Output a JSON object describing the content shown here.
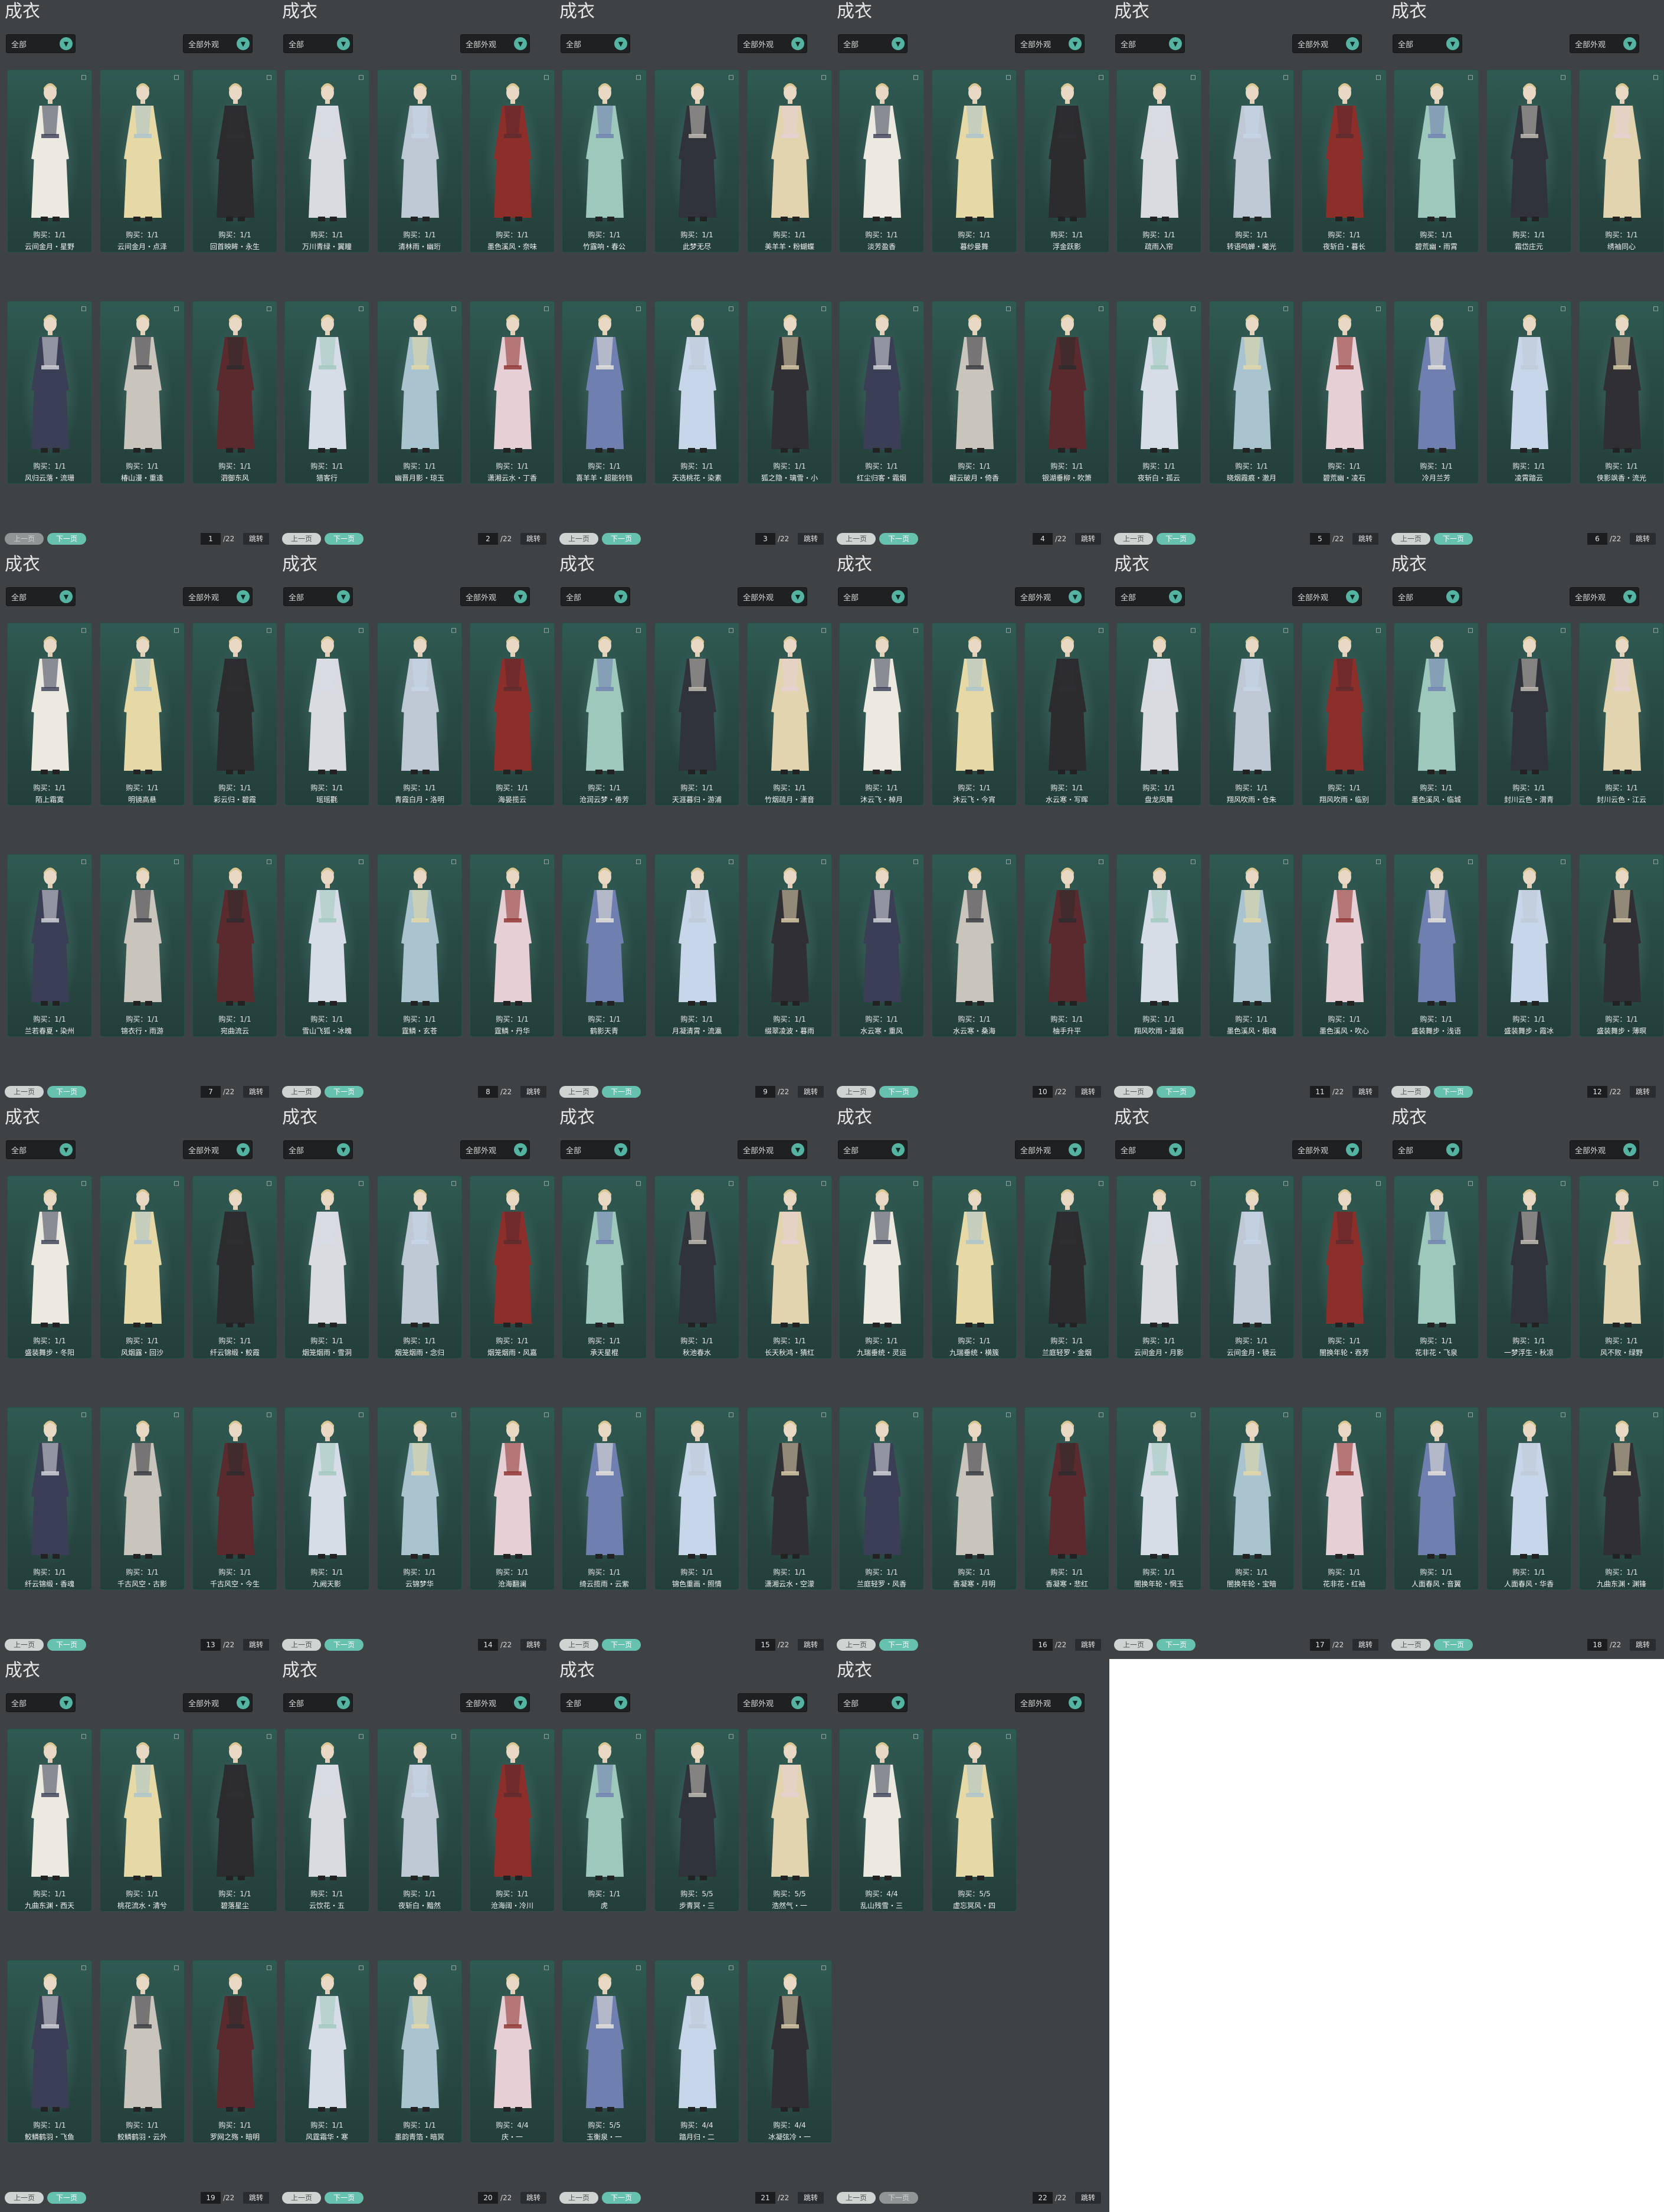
{
  "title": "成衣",
  "filter_a": "全部",
  "filter_b": "全部外观",
  "prev_label": "上一页",
  "next_label": "下一页",
  "jump_label": "跳转",
  "total_pages": "22",
  "pages": [
    {
      "page": "1",
      "items": [
        {
          "b": "购买：1/1",
          "n": "云间金月・星野"
        },
        {
          "b": "购买：1/1",
          "n": "云间金月・点泽"
        },
        {
          "b": "购买：1/1",
          "n": "回首映眸・永生"
        },
        {
          "b": "购买：1/1",
          "n": "风归云落・流珊"
        },
        {
          "b": "购买：1/1",
          "n": "椿山漫・重逢"
        },
        {
          "b": "购买：1/1",
          "n": "泗御东风"
        }
      ]
    },
    {
      "page": "2",
      "items": [
        {
          "b": "购买：1/1",
          "n": "万川青绿・翼瞳"
        },
        {
          "b": "购买：1/1",
          "n": "清林雨・幽珩"
        },
        {
          "b": "购买：1/1",
          "n": "墨色溪风・奈味"
        },
        {
          "b": "购买：1/1",
          "n": "猎客行"
        },
        {
          "b": "购买：1/1",
          "n": "幽晋月影・琼玉"
        },
        {
          "b": "购买：1/1",
          "n": "潇湘云水・丁香"
        }
      ]
    },
    {
      "page": "3",
      "items": [
        {
          "b": "购买：1/1",
          "n": "竹露响・春公"
        },
        {
          "b": "购买：1/1",
          "n": "此梦无尽"
        },
        {
          "b": "购买：1/1",
          "n": "美羊羊・粉蝴蝶"
        },
        {
          "b": "购买：1/1",
          "n": "喜羊羊・超能铃铛"
        },
        {
          "b": "购买：1/1",
          "n": "天选桃花・染素"
        },
        {
          "b": "购买：1/1",
          "n": "狐之隐・璃雪・小"
        }
      ]
    },
    {
      "page": "4",
      "items": [
        {
          "b": "购买：1/1",
          "n": "淡芳盈香"
        },
        {
          "b": "购买：1/1",
          "n": "暮纱曼舞"
        },
        {
          "b": "购买：1/1",
          "n": "浮金跃影"
        },
        {
          "b": "购买：1/1",
          "n": "红尘归客・霜烟"
        },
        {
          "b": "购买：1/1",
          "n": "翩云破月・倚香"
        },
        {
          "b": "购买：1/1",
          "n": "银湖垂柳・吹箫"
        }
      ]
    },
    {
      "page": "5",
      "items": [
        {
          "b": "购买：1/1",
          "n": "疏雨入帘"
        },
        {
          "b": "购买：1/1",
          "n": "转语鸣蝉・曦光"
        },
        {
          "b": "购买：1/1",
          "n": "夜斩白・暮长"
        },
        {
          "b": "购买：1/1",
          "n": "夜斩白・孤云"
        },
        {
          "b": "购买：1/1",
          "n": "晓烟霞痕・澈月"
        },
        {
          "b": "购买：1/1",
          "n": "碧荒幽・凌石"
        }
      ]
    },
    {
      "page": "6",
      "items": [
        {
          "b": "购买：1/1",
          "n": "碧荒幽・雨霄"
        },
        {
          "b": "购买：1/1",
          "n": "霜岱庄元"
        },
        {
          "b": "购买：1/1",
          "n": "绣袖同心"
        },
        {
          "b": "购买：1/1",
          "n": "冷月兰芳"
        },
        {
          "b": "购买：1/1",
          "n": "凌霄踏云"
        },
        {
          "b": "购买：1/1",
          "n": "侠影飒香・流光"
        }
      ]
    },
    {
      "page": "7",
      "items": [
        {
          "b": "购买：1/1",
          "n": "陌上霜寞"
        },
        {
          "b": "购买：1/1",
          "n": "明镜高悬"
        },
        {
          "b": "购买：1/1",
          "n": "彩云归・碧霞"
        },
        {
          "b": "购买：1/1",
          "n": "兰若春夏・染州"
        },
        {
          "b": "购买：1/1",
          "n": "锦衣行・雨游"
        },
        {
          "b": "购买：1/1",
          "n": "宛曲流云"
        }
      ]
    },
    {
      "page": "8",
      "items": [
        {
          "b": "购买：1/1",
          "n": "瑶瑶氍"
        },
        {
          "b": "购买：1/1",
          "n": "青霞白月・洛明"
        },
        {
          "b": "购买：1/1",
          "n": "海晏揽云"
        },
        {
          "b": "购买：1/1",
          "n": "雪山飞狐・冰魄"
        },
        {
          "b": "购买：1/1",
          "n": "霆鳞・玄苍"
        },
        {
          "b": "购买：1/1",
          "n": "霆鳞・丹华"
        }
      ]
    },
    {
      "page": "9",
      "items": [
        {
          "b": "购买：1/1",
          "n": "沧润云梦・倦芳"
        },
        {
          "b": "购买：1/1",
          "n": "天涯暮归・游浦"
        },
        {
          "b": "购买：1/1",
          "n": "竹烟疏月・潇音"
        },
        {
          "b": "购买：1/1",
          "n": "鹤影天青"
        },
        {
          "b": "购买：1/1",
          "n": "月凝清霄・流瀛"
        },
        {
          "b": "购买：1/1",
          "n": "缀翠凌波・暮雨"
        }
      ]
    },
    {
      "page": "10",
      "items": [
        {
          "b": "购买：1/1",
          "n": "沐云飞・棹月"
        },
        {
          "b": "购买：1/1",
          "n": "沐云飞・今宵"
        },
        {
          "b": "购买：1/1",
          "n": "水云寒・写晖"
        },
        {
          "b": "购买：1/1",
          "n": "水云寒・重风"
        },
        {
          "b": "购买：1/1",
          "n": "水云寒・桑海"
        },
        {
          "b": "购买：1/1",
          "n": "柚手升平"
        }
      ]
    },
    {
      "page": "11",
      "items": [
        {
          "b": "购买：1/1",
          "n": "盘龙凤舞"
        },
        {
          "b": "购买：1/1",
          "n": "翔风吹雨・仓朱"
        },
        {
          "b": "购买：1/1",
          "n": "翔风吹雨・临别"
        },
        {
          "b": "购买：1/1",
          "n": "翔风吹雨・道烟"
        },
        {
          "b": "购买：1/1",
          "n": "墨色溪风・烟魂"
        },
        {
          "b": "购买：1/1",
          "n": "墨色溪风・吹心"
        }
      ]
    },
    {
      "page": "12",
      "items": [
        {
          "b": "购买：1/1",
          "n": "墨色溪风・临城"
        },
        {
          "b": "购买：1/1",
          "n": "封川云色・渭青"
        },
        {
          "b": "购买：1/1",
          "n": "封川云色・江云"
        },
        {
          "b": "购买：1/1",
          "n": "盛装舞步・浅语"
        },
        {
          "b": "购买：1/1",
          "n": "盛装舞步・霞冰"
        },
        {
          "b": "购买：1/1",
          "n": "盛装舞步・薄暝"
        }
      ]
    },
    {
      "page": "13",
      "items": [
        {
          "b": "购买：1/1",
          "n": "盛装舞步・冬阳"
        },
        {
          "b": "购买：1/1",
          "n": "风烟露・回沙"
        },
        {
          "b": "购买：1/1",
          "n": "纤云锦缎・鲛霞"
        },
        {
          "b": "购买：1/1",
          "n": "纤云锦缎・香魂"
        },
        {
          "b": "购买：1/1",
          "n": "千古风空・古影"
        },
        {
          "b": "购买：1/1",
          "n": "千古风空・今生"
        }
      ]
    },
    {
      "page": "14",
      "items": [
        {
          "b": "购买：1/1",
          "n": "烟笼烟雨・雪洞"
        },
        {
          "b": "购买：1/1",
          "n": "烟笼烟雨・念归"
        },
        {
          "b": "购买：1/1",
          "n": "烟笼烟雨・风嘉"
        },
        {
          "b": "购买：1/1",
          "n": "九阙天影"
        },
        {
          "b": "购买：1/1",
          "n": "云锦梦华"
        },
        {
          "b": "购买：1/1",
          "n": "沧海翻澜"
        }
      ]
    },
    {
      "page": "15",
      "items": [
        {
          "b": "购买：1/1",
          "n": "承天星棍"
        },
        {
          "b": "购买：1/1",
          "n": "秋池春水"
        },
        {
          "b": "购买：1/1",
          "n": "长天秋鸿・猜红"
        },
        {
          "b": "购买：1/1",
          "n": "绮云揽雨・云紫"
        },
        {
          "b": "购买：1/1",
          "n": "锦色重画・照情"
        },
        {
          "b": "购买：1/1",
          "n": "潇湘云水・空濛"
        }
      ]
    },
    {
      "page": "16",
      "items": [
        {
          "b": "购买：1/1",
          "n": "九瑞垂统・灵运"
        },
        {
          "b": "购买：1/1",
          "n": "九瑞垂统・横簇"
        },
        {
          "b": "购买：1/1",
          "n": "兰庭轻罗・金烟"
        },
        {
          "b": "购买：1/1",
          "n": "兰庭轻罗・风香"
        },
        {
          "b": "购买：1/1",
          "n": "香凝寒・月明"
        },
        {
          "b": "购买：1/1",
          "n": "香凝寒・悲红"
        }
      ]
    },
    {
      "page": "17",
      "items": [
        {
          "b": "购买：1/1",
          "n": "云间金月・月影"
        },
        {
          "b": "购买：1/1",
          "n": "云间金月・镜云"
        },
        {
          "b": "购买：1/1",
          "n": "闇换年轮・吞芳"
        },
        {
          "b": "购买：1/1",
          "n": "闇换年轮・惘玉"
        },
        {
          "b": "购买：1/1",
          "n": "闇换年轮・宝暗"
        },
        {
          "b": "购买：1/1",
          "n": "花非花・红袖"
        }
      ]
    },
    {
      "page": "18",
      "items": [
        {
          "b": "购买：1/1",
          "n": "花非花・飞泉"
        },
        {
          "b": "购买：1/1",
          "n": "一梦浮生・秋凉"
        },
        {
          "b": "购买：1/1",
          "n": "风不败・绿野"
        },
        {
          "b": "购买：1/1",
          "n": "人面春风・音翼"
        },
        {
          "b": "购买：1/1",
          "n": "人面春风・华香"
        },
        {
          "b": "购买：1/1",
          "n": "九曲东渊・渊锋"
        }
      ]
    },
    {
      "page": "19",
      "items": [
        {
          "b": "购买：1/1",
          "n": "九曲东渊・西天"
        },
        {
          "b": "购买：1/1",
          "n": "桃花流水・清兮"
        },
        {
          "b": "购买：1/1",
          "n": "碧落星尘"
        },
        {
          "b": "购买：1/1",
          "n": "鲛鳞鹤羽・飞鱼"
        },
        {
          "b": "购买：1/1",
          "n": "鲛鳞鹤羽・云外"
        },
        {
          "b": "购买：1/1",
          "n": "罗网之殇・暗明"
        }
      ]
    },
    {
      "page": "20",
      "items": [
        {
          "b": "购买：1/1",
          "n": "云饮花・五"
        },
        {
          "b": "购买：1/1",
          "n": "夜斩白・黯然"
        },
        {
          "b": "购买：1/1",
          "n": "沧海阔・冷川"
        },
        {
          "b": "购买：1/1",
          "n": "风霆霜华・寒"
        },
        {
          "b": "购买：1/1",
          "n": "墨韵青箔・暗冥"
        },
        {
          "b": "购买：4/4",
          "n": "庆・一"
        }
      ]
    },
    {
      "page": "21",
      "items": [
        {
          "b": "购买：1/1",
          "n": "虎"
        },
        {
          "b": "购买：5/5",
          "n": "步青冥・三"
        },
        {
          "b": "购买：5/5",
          "n": "浩然气・一"
        },
        {
          "b": "购买：5/5",
          "n": "玉衡泉・一"
        },
        {
          "b": "购买：4/4",
          "n": "踏月归・二"
        },
        {
          "b": "购买：4/4",
          "n": "冰凝弦冷・一"
        }
      ]
    },
    {
      "page": "22",
      "items": [
        {
          "b": "购买：4/4",
          "n": "乱山残雪・三"
        },
        {
          "b": "购买：5/5",
          "n": "虚忘冥风・四"
        }
      ]
    }
  ]
}
